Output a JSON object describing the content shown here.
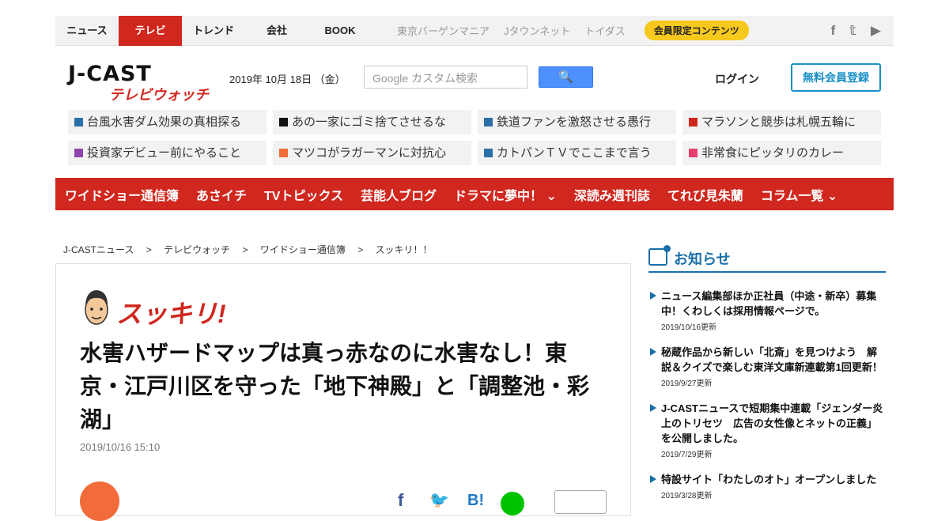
{
  "topnav": {
    "items": [
      "ニュース",
      "テレビ",
      "トレンド",
      "会社",
      "BOOK"
    ],
    "active_index": 1,
    "sub_links": [
      "東京バーゲンマニア",
      "Jタウンネット",
      "トイダス"
    ],
    "badge": "会員限定コンテンツ",
    "social": [
      "f",
      "𝕥",
      "▶"
    ]
  },
  "header": {
    "logo_main": "J-CAST",
    "logo_sub": "テレビウォッチ",
    "date": "2019年 10月 18日 （金）",
    "search_placeholder": "Google カスタム検索",
    "search_button": "🔍",
    "login": "ログイン",
    "register": "無料会員登録"
  },
  "topics": [
    {
      "label": "台風水害ダム効果の真相探る",
      "color": "#2b6fa8"
    },
    {
      "label": "あの一家にゴミ捨てさせるな",
      "color": "#111111"
    },
    {
      "label": "鉄道ファンを激怒させる愚行",
      "color": "#2b6fa8"
    },
    {
      "label": "マラソンと競歩は札幌五輪に",
      "color": "#d0271e"
    },
    {
      "label": "投資家デビュー前にやること",
      "color": "#8e44ad"
    },
    {
      "label": "マツコがラガーマンに対抗心",
      "color": "#f26b3a"
    },
    {
      "label": "カトパンＴＶでここまで言う",
      "color": "#2b6fa8"
    },
    {
      "label": "非常食にピッタリのカレー",
      "color": "#e83e70"
    }
  ],
  "rednav": [
    "ワイドショー通信簿",
    "あさイチ",
    "TVトピックス",
    "芸能人ブログ",
    "ドラマに夢中！ ⌄",
    "深読み週刊誌",
    "てれび見朱蘭",
    "コラム一覧 ⌄"
  ],
  "breadcrumb": [
    "J-CASTニュース",
    ">",
    "テレビウォッチ",
    ">",
    "ワイドショー通信簿",
    ">",
    "スッキリ！！"
  ],
  "article": {
    "program": "スッキリ!",
    "headline": "水害ハザードマップは真っ赤なのに水害なし！東京・江戸川区を守った「地下神殿」と「調整池・彩湖」",
    "date": "2019/10/16 15:10"
  },
  "sidebar": {
    "title": "お知らせ",
    "news": [
      {
        "title": "ニュース編集部ほか正社員（中途・新卒）募集中！くわしくは採用情報ページで。",
        "date": "2019/10/16更新"
      },
      {
        "title": "秘蔵作品から新しい「北斎」を見つけよう　解説＆クイズで楽しむ東洋文庫新連載第1回更新！",
        "date": "2019/9/27更新"
      },
      {
        "title": "J-CASTニュースで短期集中連載「ジェンダー炎上のトリセツ　広告の女性像とネットの正義」を公開しました。",
        "date": "2019/7/29更新"
      },
      {
        "title": "特設サイト「わたしのオト」オープンしました",
        "date": "2019/3/28更新"
      }
    ]
  }
}
